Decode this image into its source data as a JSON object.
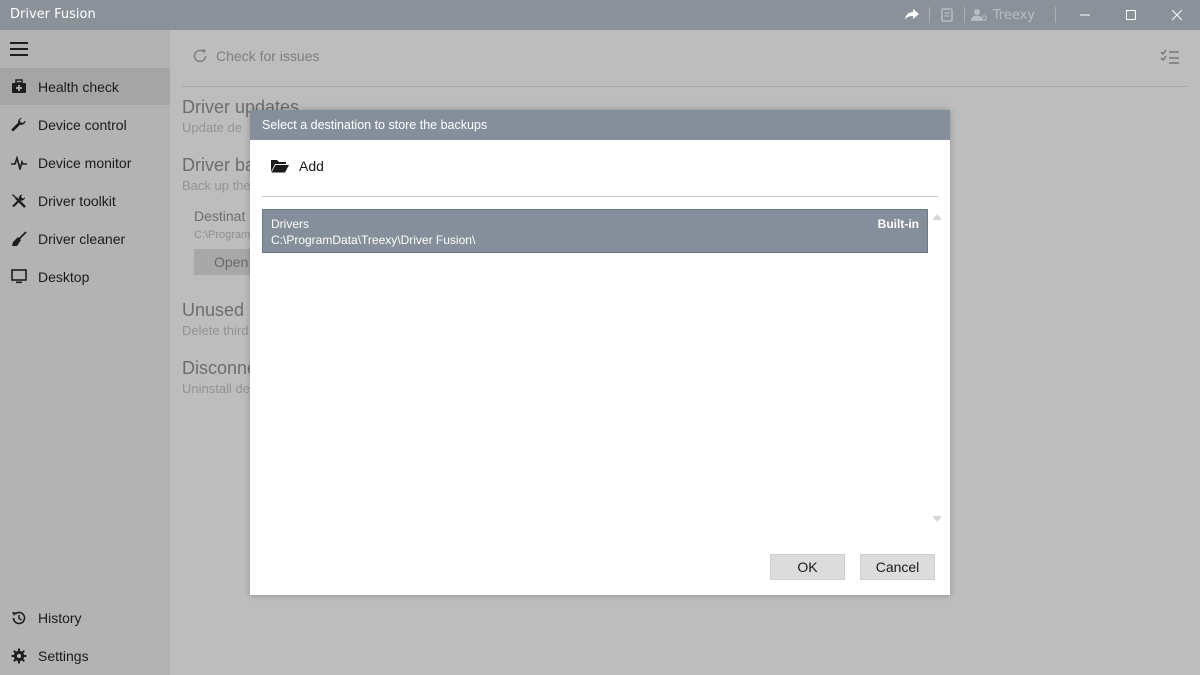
{
  "window": {
    "title": "Driver Fusion",
    "user": "Treexy"
  },
  "sidebar": {
    "items": [
      {
        "label": "Health check",
        "icon": "medkit-icon",
        "active": true
      },
      {
        "label": "Device control",
        "icon": "wrench-icon"
      },
      {
        "label": "Device monitor",
        "icon": "pulse-icon"
      },
      {
        "label": "Driver toolkit",
        "icon": "tools-icon"
      },
      {
        "label": "Driver cleaner",
        "icon": "broom-icon"
      },
      {
        "label": "Desktop",
        "icon": "monitor-icon"
      }
    ],
    "bottom_items": [
      {
        "label": "History",
        "icon": "history-icon"
      },
      {
        "label": "Settings",
        "icon": "gear-icon"
      }
    ]
  },
  "main": {
    "check_issues": "Check for issues",
    "sections": [
      {
        "title": "Driver updates",
        "subtitle": "Update de"
      },
      {
        "title": "Driver ba",
        "subtitle": "Back up the"
      },
      {
        "title": "Unused",
        "subtitle": "Delete third"
      },
      {
        "title": "Disconne",
        "subtitle": "Uninstall de"
      }
    ],
    "destination_label": "Destinat",
    "destination_path": "C:\\Program",
    "open_button": "Open"
  },
  "dialog": {
    "title": "Select a destination to store the backups",
    "add_label": "Add",
    "items": [
      {
        "name": "Drivers",
        "path": "C:\\ProgramData\\Treexy\\Driver Fusion\\",
        "badge": "Built-in"
      }
    ],
    "ok_label": "OK",
    "cancel_label": "Cancel"
  },
  "colors": {
    "titlebar": "#8a9199",
    "dialog_header": "#858f9b",
    "selected_item": "#858f9b"
  }
}
